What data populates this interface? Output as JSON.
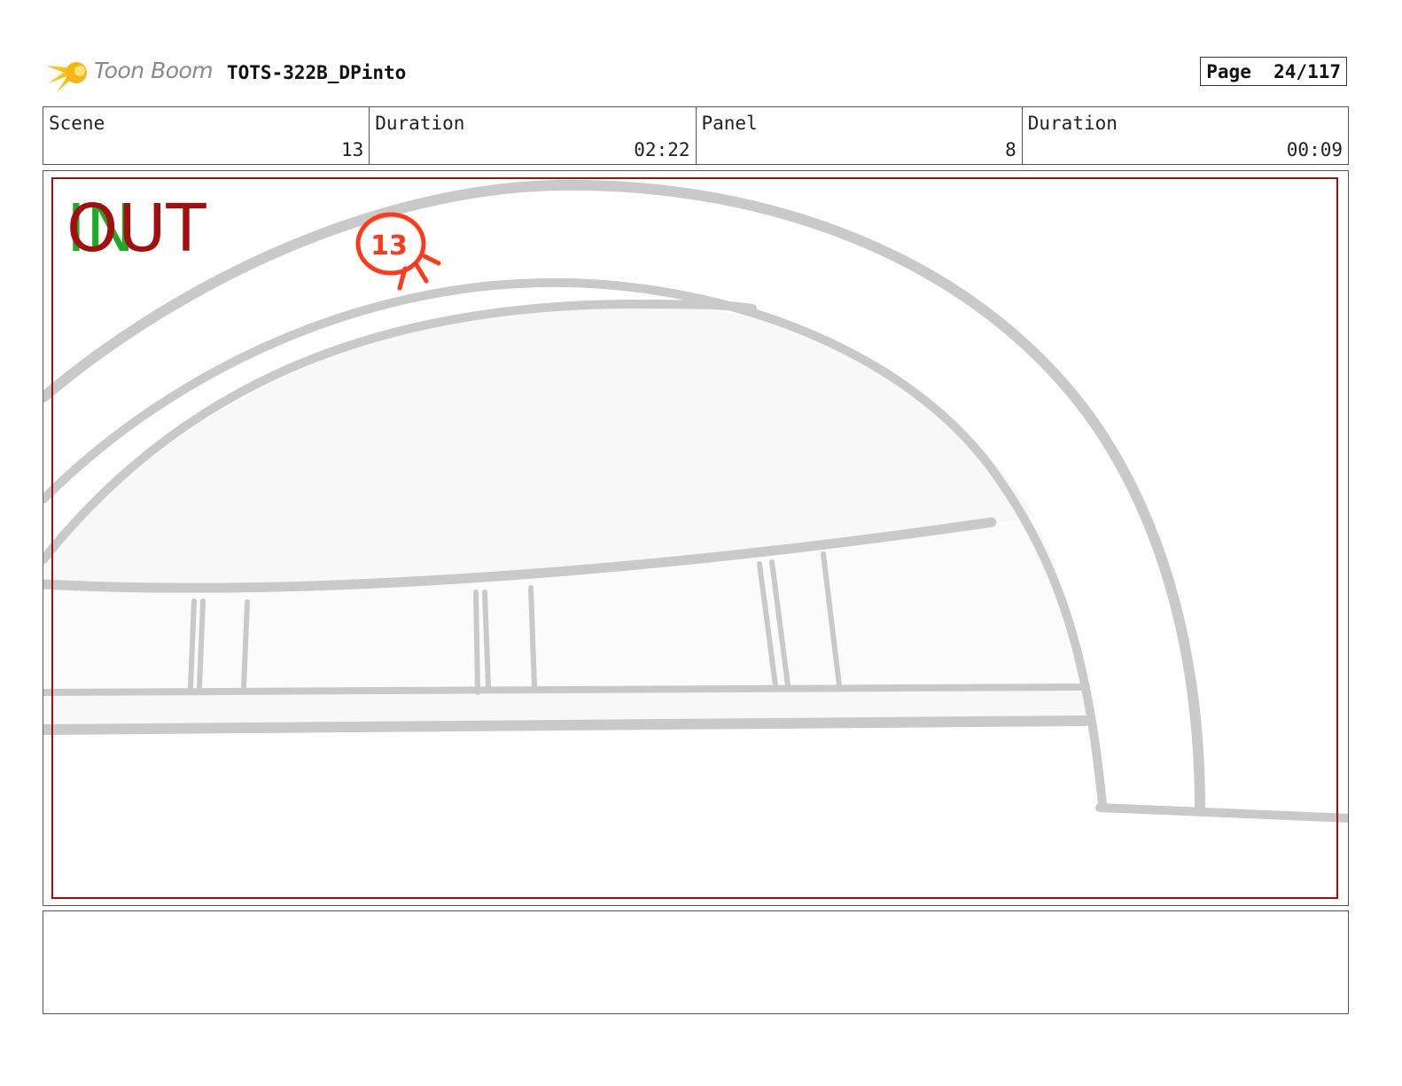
{
  "header": {
    "brand_name": "Toon Boom",
    "project_title": "TOTS-322B_DPinto",
    "page_label": "Page",
    "page_value": "24/117"
  },
  "info": {
    "scene_label": "Scene",
    "scene_value": "13",
    "scene_duration_label": "Duration",
    "scene_duration_value": "02:22",
    "panel_label": "Panel",
    "panel_value": "8",
    "panel_duration_label": "Duration",
    "panel_duration_value": "00:09"
  },
  "panel": {
    "in_marker": "IN",
    "out_marker": "OUT",
    "scene_callout": "13",
    "colors": {
      "safe_frame": "#a50e0e",
      "sketch": "#c9c9c9",
      "callout": "#ff3a1a",
      "in_marker": "#1faa2a",
      "out_marker": "#a50e0e"
    }
  },
  "notes": {
    "text": ""
  }
}
